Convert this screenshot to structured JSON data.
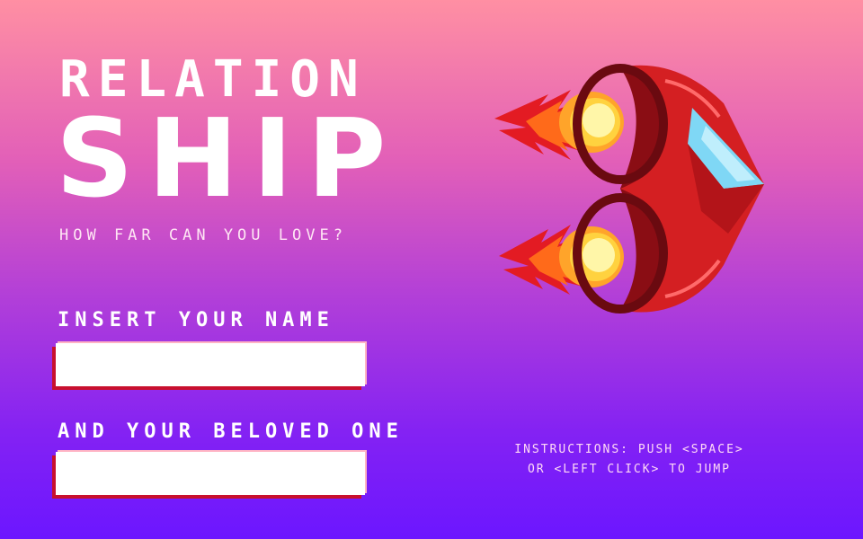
{
  "title": {
    "line1": "RELATION",
    "line2": "SHIP",
    "tagline": "HOW FAR CAN YOU LOVE?"
  },
  "form": {
    "name_label": "INSERT YOUR NAME",
    "name_value": "",
    "beloved_label": "AND YOUR BELOVED ONE",
    "beloved_value": ""
  },
  "instructions": {
    "line1": "INSTRUCTIONS: PUSH <SPACE>",
    "line2": "OR <LEFT CLICK> TO JUMP"
  },
  "colors": {
    "ship_red": "#d41f22",
    "ship_dark": "#8a0d14",
    "window_blue": "#7fd7f5",
    "flame_yellow": "#fff27a",
    "flame_orange": "#ff8a1e"
  },
  "icons": {
    "ship": "heart-ship-icon"
  }
}
